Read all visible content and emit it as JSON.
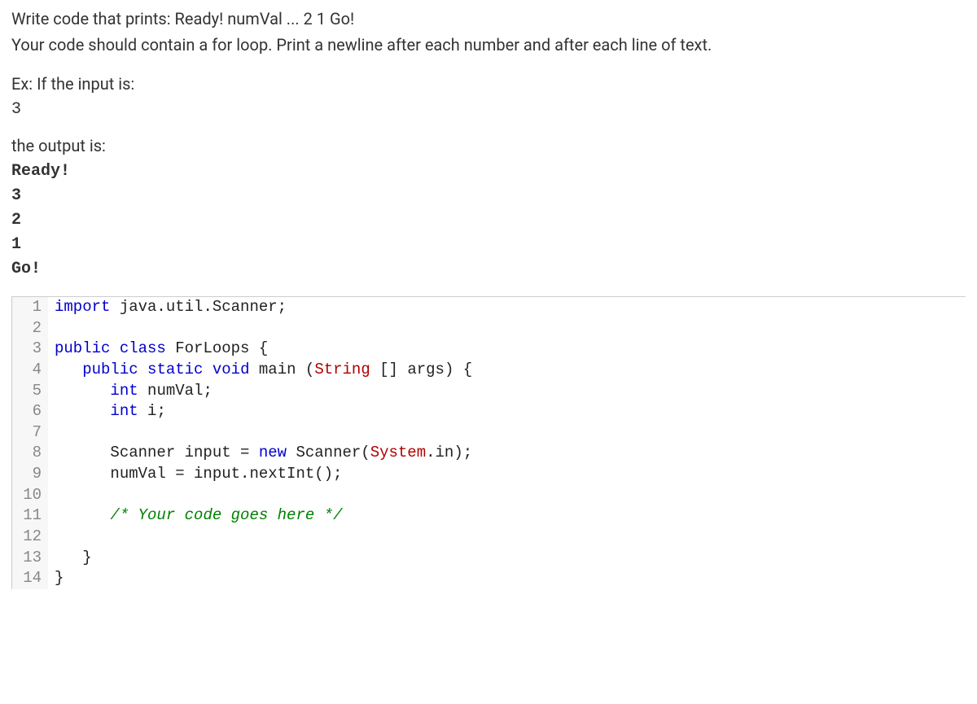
{
  "prompt": {
    "line1": "Write code that prints: Ready! numVal ... 2 1 Go!",
    "line2": "Your code should contain a for loop. Print a newline after each number and after each line of text.",
    "ex_label": "Ex: If the input is:",
    "input_sample": "3",
    "output_label": "the output is:",
    "output_lines": [
      "Ready!",
      "3",
      "2",
      "1",
      "Go!"
    ]
  },
  "code": {
    "lines": [
      {
        "n": 1,
        "tokens": [
          [
            "kw",
            "import"
          ],
          [
            "",
            " java.util.Scanner;"
          ]
        ]
      },
      {
        "n": 2,
        "tokens": [
          [
            "",
            ""
          ]
        ]
      },
      {
        "n": 3,
        "tokens": [
          [
            "kw",
            "public"
          ],
          [
            "",
            " "
          ],
          [
            "kw",
            "class"
          ],
          [
            "",
            " ForLoops {"
          ]
        ]
      },
      {
        "n": 4,
        "tokens": [
          [
            "",
            "   "
          ],
          [
            "kw",
            "public"
          ],
          [
            "",
            " "
          ],
          [
            "kw",
            "static"
          ],
          [
            "",
            " "
          ],
          [
            "kw",
            "void"
          ],
          [
            "",
            " main ("
          ],
          [
            "type",
            "String"
          ],
          [
            "",
            " [] args) {"
          ]
        ]
      },
      {
        "n": 5,
        "tokens": [
          [
            "",
            "      "
          ],
          [
            "kw",
            "int"
          ],
          [
            "",
            " numVal;"
          ]
        ]
      },
      {
        "n": 6,
        "tokens": [
          [
            "",
            "      "
          ],
          [
            "kw",
            "int"
          ],
          [
            "",
            " i;"
          ]
        ]
      },
      {
        "n": 7,
        "tokens": [
          [
            "",
            ""
          ]
        ]
      },
      {
        "n": 8,
        "tokens": [
          [
            "",
            "      Scanner input = "
          ],
          [
            "kw",
            "new"
          ],
          [
            "",
            " Scanner("
          ],
          [
            "type",
            "System"
          ],
          [
            "",
            ".in);"
          ]
        ]
      },
      {
        "n": 9,
        "tokens": [
          [
            "",
            "      numVal = input.nextInt();"
          ]
        ]
      },
      {
        "n": 10,
        "tokens": [
          [
            "",
            ""
          ]
        ]
      },
      {
        "n": 11,
        "tokens": [
          [
            "",
            "      "
          ],
          [
            "cmt",
            "/* Your code goes here */"
          ]
        ]
      },
      {
        "n": 12,
        "tokens": [
          [
            "",
            ""
          ]
        ]
      },
      {
        "n": 13,
        "tokens": [
          [
            "",
            "   }"
          ]
        ]
      },
      {
        "n": 14,
        "tokens": [
          [
            "",
            "}"
          ]
        ]
      }
    ]
  }
}
